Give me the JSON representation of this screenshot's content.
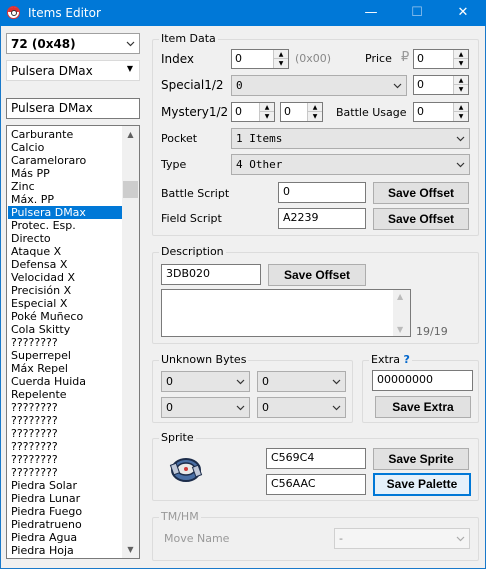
{
  "window": {
    "title": "Items Editor",
    "minimize": "—",
    "maximize": "☐",
    "close": "✕"
  },
  "left": {
    "item_select": "72  (0x48)",
    "item_type": "Pulsera DMax",
    "name_field": "Pulsera DMax",
    "list": [
      "Carburante",
      "Calcio",
      "Carameloraro",
      "Más PP",
      "Zinc",
      "Máx. PP",
      "Pulsera DMax",
      "Protec. Esp.",
      "Directo",
      "Ataque X",
      "Defensa X",
      "Velocidad X",
      "Precisión X",
      "Especial X",
      "Poké Muñeco",
      "Cola Skitty",
      "????????",
      "Superrepel",
      "Máx Repel",
      "Cuerda Huida",
      "Repelente",
      "????????",
      "????????",
      "????????",
      "????????",
      "????????",
      "????????",
      "Piedra Solar",
      "Piedra Lunar",
      "Piedra Fuego",
      "Piedratrueno",
      "Piedra Agua",
      "Piedra Hoja"
    ],
    "selected_index": 6
  },
  "item_data": {
    "group_label": "Item Data",
    "index_label": "Index",
    "index_value": "0",
    "index_hex": "(0x00)",
    "price_label": "Price",
    "price_value": "0",
    "special_label": "Special1/2",
    "special_combo": "0",
    "special_value": "0",
    "mystery_label": "Mystery1/2",
    "mystery_1": "0",
    "mystery_2": "0",
    "battle_usage_label": "Battle Usage",
    "battle_usage_value": "0",
    "pocket_label": "Pocket",
    "pocket_value": "1 Items",
    "type_label": "Type",
    "type_value": "4 Other",
    "battle_script_label": "Battle Script",
    "battle_script_value": "0",
    "field_script_label": "Field Script",
    "field_script_value": "A2239",
    "save_offset": "Save Offset"
  },
  "description": {
    "group_label": "Description",
    "offset_value": "3DB020",
    "save_offset": "Save Offset",
    "text": "",
    "counter": "19/19"
  },
  "unknown_bytes": {
    "group_label": "Unknown Bytes",
    "values": [
      "0",
      "0",
      "0",
      "0"
    ]
  },
  "extra": {
    "group_label": "Extra",
    "help": "?",
    "value": "00000000",
    "save": "Save Extra"
  },
  "sprite": {
    "group_label": "Sprite",
    "sprite_offset": "C569C4",
    "palette_offset": "C56AAC",
    "save_sprite": "Save Sprite",
    "save_palette": "Save Palette"
  },
  "tmhm": {
    "group_label": "TM/HM",
    "move_label": "Move Name",
    "move_value": "-"
  },
  "colors": {
    "titlebar": "#0078d7",
    "selection": "#0078d7"
  }
}
